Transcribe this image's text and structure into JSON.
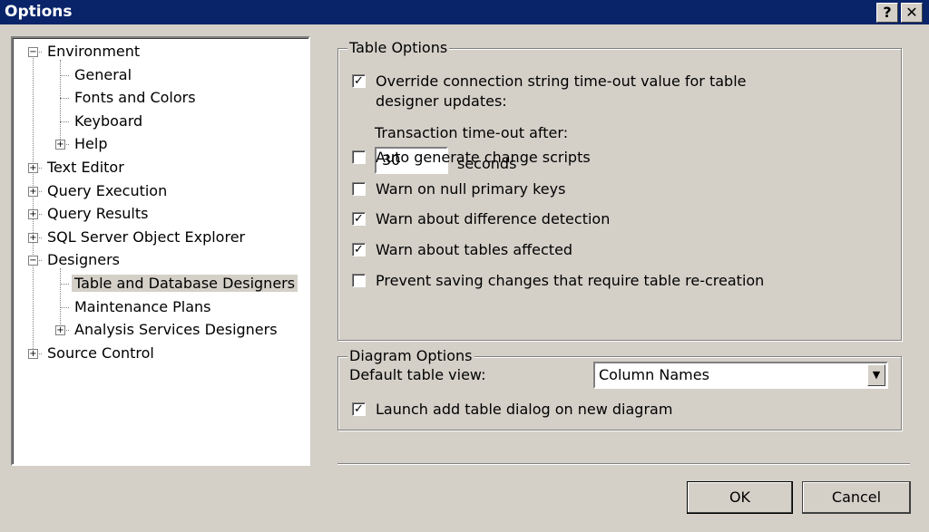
{
  "window": {
    "title": "Options",
    "help_label": "?",
    "close_label": "✕"
  },
  "tree": [
    {
      "label": "Environment",
      "level": 0,
      "expander": "−"
    },
    {
      "label": "General",
      "level": 1
    },
    {
      "label": "Fonts and Colors",
      "level": 1
    },
    {
      "label": "Keyboard",
      "level": 1
    },
    {
      "label": "Help",
      "level": 1,
      "expander": "+"
    },
    {
      "label": "Text Editor",
      "level": 0,
      "expander": "+"
    },
    {
      "label": "Query Execution",
      "level": 0,
      "expander": "+"
    },
    {
      "label": "Query Results",
      "level": 0,
      "expander": "+"
    },
    {
      "label": "SQL Server Object Explorer",
      "level": 0,
      "expander": "+"
    },
    {
      "label": "Designers",
      "level": 0,
      "expander": "−"
    },
    {
      "label": "Table and Database Designers",
      "level": 1,
      "selected": true
    },
    {
      "label": "Maintenance Plans",
      "level": 1
    },
    {
      "label": "Analysis Services Designers",
      "level": 1,
      "expander": "+"
    },
    {
      "label": "Source Control",
      "level": 0,
      "expander": "+"
    }
  ],
  "table_options": {
    "title": "Table Options",
    "override": {
      "line1": "Override connection string time-out value for table",
      "line2": "designer updates:",
      "checked": true
    },
    "timeout_label": "Transaction time-out after:",
    "timeout_value": "30",
    "timeout_unit": "seconds",
    "checks": [
      {
        "label": "Auto generate change scripts",
        "checked": false
      },
      {
        "label": "Warn on null primary keys",
        "checked": false
      },
      {
        "label": "Warn about difference detection",
        "checked": true
      },
      {
        "label": "Warn about tables affected",
        "checked": true
      },
      {
        "label": "Prevent saving changes that require table re-creation",
        "checked": false
      }
    ]
  },
  "diagram_options": {
    "title": "Diagram Options",
    "default_view_label": "Default table view:",
    "default_view_value": "Column Names",
    "launch": {
      "label": "Launch add table dialog on new diagram",
      "checked": true
    }
  },
  "buttons": {
    "ok": "OK",
    "cancel": "Cancel"
  }
}
